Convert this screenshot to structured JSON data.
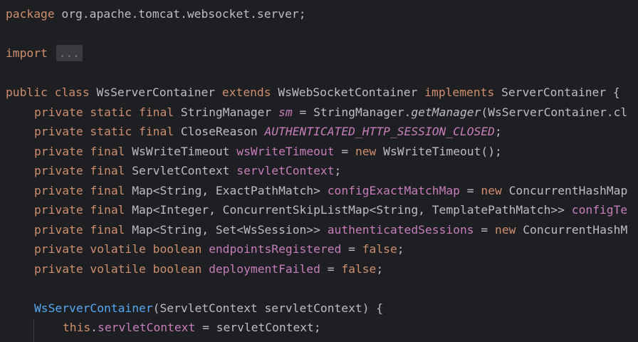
{
  "code": {
    "line1": {
      "kw": "package",
      "rest": " org.apache.tomcat.websocket.server;"
    },
    "line2": {
      "kw": "import",
      "folded": "..."
    },
    "line3": {
      "kw_public": "public",
      "kw_class": "class",
      "name": "WsServerContainer",
      "kw_extends": "extends",
      "parent": "WsWebSocketContainer",
      "kw_implements": "implements",
      "iface": "ServerContainer {"
    },
    "line4": {
      "mods": "private static final",
      "type": "StringManager",
      "field": "sm",
      "eq": " = StringManager.",
      "call": "getManager",
      "rest": "(WsServerContainer.cl"
    },
    "line5": {
      "mods": "private static final",
      "type": "CloseReason",
      "field": "AUTHENTICATED_HTTP_SESSION_CLOSED",
      "rest": ";"
    },
    "line6": {
      "mods": "private final",
      "type": "WsWriteTimeout",
      "field": "wsWriteTimeout",
      "eq": " = ",
      "kw_new": "new",
      "rest": " WsWriteTimeout();"
    },
    "line7": {
      "mods": "private final",
      "type": "ServletContext",
      "field": "servletContext",
      "rest": ";"
    },
    "line8": {
      "mods": "private final",
      "type": "Map<String, ExactPathMatch>",
      "field": "configExactMatchMap",
      "eq": " = ",
      "kw_new": "new",
      "rest": " ConcurrentHashMap"
    },
    "line9": {
      "mods": "private final",
      "type": "Map<Integer, ConcurrentSkipListMap<String, TemplatePathMatch>>",
      "field": "configTe"
    },
    "line10": {
      "mods": "private final",
      "type": "Map<String, Set<WsSession>>",
      "field": "authenticatedSessions",
      "eq": " = ",
      "kw_new": "new",
      "rest": " ConcurrentHashM"
    },
    "line11": {
      "mods": "private volatile boolean",
      "field": "endpointsRegistered",
      "eq": " = ",
      "kw_false": "false",
      "rest": ";"
    },
    "line12": {
      "mods": "private volatile boolean",
      "field": "deploymentFailed",
      "eq": " = ",
      "kw_false": "false",
      "rest": ";"
    },
    "line13": {
      "ctor": "WsServerContainer",
      "rest": "(ServletContext servletContext) {"
    },
    "line14": {
      "kw_this": "this",
      "dot": ".",
      "field": "servletContext",
      "rest": " = servletContext;"
    }
  }
}
